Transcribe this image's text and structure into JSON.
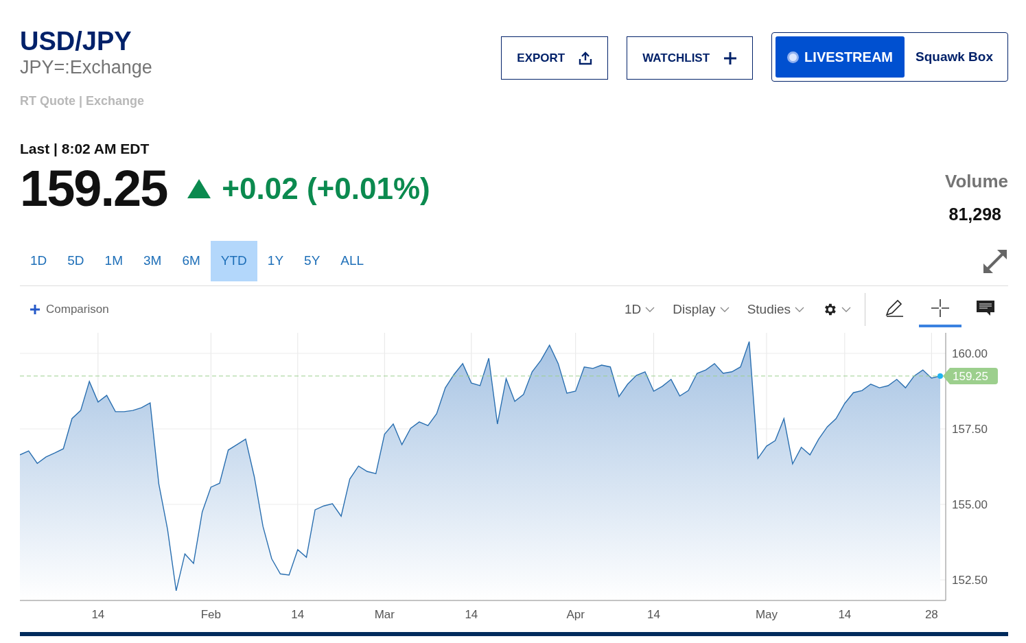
{
  "header": {
    "symbol": "USD/JPY",
    "ticker": "JPY=:Exchange",
    "quote_source": "RT Quote | Exchange"
  },
  "actions": [
    {
      "kind": "export",
      "label": "EXPORT"
    },
    {
      "kind": "watchlist",
      "label": "WATCHLIST"
    }
  ],
  "live": {
    "label": "LIVESTREAM",
    "show": "Squawk Box"
  },
  "quote": {
    "last_label": "Last | 8:02 AM EDT",
    "price": "159.25",
    "change": "+0.02 (+0.01%)",
    "volume_label": "Volume",
    "volume": "81,298"
  },
  "ranges": [
    {
      "label": "1D",
      "selected": false
    },
    {
      "label": "5D",
      "selected": false
    },
    {
      "label": "1M",
      "selected": false
    },
    {
      "label": "3M",
      "selected": false
    },
    {
      "label": "6M",
      "selected": false
    },
    {
      "label": "YTD",
      "selected": true
    },
    {
      "label": "1Y",
      "selected": false
    },
    {
      "label": "5Y",
      "selected": false
    },
    {
      "label": "ALL",
      "selected": false
    }
  ],
  "toolbar": {
    "comparison": "Comparison",
    "menus": [
      {
        "kind": "text",
        "label": "1D"
      },
      {
        "kind": "text",
        "label": "Display"
      },
      {
        "kind": "text",
        "label": "Studies"
      },
      {
        "kind": "settings"
      }
    ],
    "tools": [
      {
        "kind": "draw",
        "selected": false
      },
      {
        "kind": "crosshair",
        "selected": true
      },
      {
        "kind": "comment",
        "selected": false
      }
    ]
  },
  "chart": {
    "chart_data": {
      "type": "area",
      "grid": true,
      "ref_lines": [
        {
          "axis": "y",
          "value": 159.25,
          "label": "159.25",
          "color": "#9ccf8d"
        }
      ],
      "categories": [
        null,
        null,
        null,
        null,
        null,
        null,
        null,
        null,
        null,
        "14",
        null,
        null,
        null,
        null,
        null,
        null,
        null,
        null,
        null,
        null,
        null,
        null,
        "Feb",
        null,
        null,
        null,
        null,
        null,
        null,
        null,
        null,
        null,
        "14",
        null,
        null,
        null,
        null,
        null,
        null,
        null,
        null,
        null,
        "Mar",
        null,
        null,
        null,
        null,
        null,
        null,
        null,
        null,
        null,
        "14",
        null,
        null,
        null,
        null,
        null,
        null,
        null,
        null,
        null,
        null,
        null,
        "Apr",
        null,
        null,
        null,
        null,
        null,
        null,
        null,
        null,
        "14",
        null,
        null,
        null,
        null,
        null,
        null,
        null,
        null,
        null,
        null,
        null,
        null,
        "May",
        null,
        null,
        null,
        null,
        null,
        null,
        null,
        null,
        "14",
        null,
        null,
        null,
        null,
        null,
        null,
        null,
        null,
        null,
        "28",
        null
      ],
      "ylim": [
        151.82,
        160.68
      ],
      "yticks": [
        {
          "value": 152.5,
          "label": "152.50"
        },
        {
          "value": 155,
          "label": "155.00"
        },
        {
          "value": 157.5,
          "label": "157.50"
        },
        {
          "value": 160,
          "label": "160.00"
        }
      ],
      "series": [
        {
          "color": "#2a6fb0",
          "values": [
            156.64,
            156.77,
            156.36,
            156.57,
            156.7,
            156.84,
            157.84,
            158.11,
            159.07,
            158.39,
            158.61,
            158.07,
            158.07,
            158.11,
            158.2,
            158.36,
            155.68,
            154.18,
            152.14,
            153.36,
            153.05,
            154.75,
            155.57,
            155.7,
            156.8,
            156.98,
            157.16,
            155.91,
            154.27,
            153.2,
            152.7,
            152.66,
            153.5,
            153.25,
            154.82,
            154.95,
            155.02,
            154.61,
            155.84,
            156.27,
            156.09,
            156.02,
            157.32,
            157.66,
            156.98,
            157.52,
            157.73,
            157.61,
            158.0,
            158.86,
            159.3,
            159.66,
            159.02,
            158.93,
            159.84,
            157.66,
            159.16,
            158.41,
            158.64,
            159.39,
            159.77,
            160.27,
            159.66,
            158.68,
            158.75,
            159.55,
            159.5,
            159.61,
            159.55,
            158.57,
            158.98,
            159.27,
            159.39,
            158.75,
            158.91,
            159.14,
            158.59,
            158.77,
            159.34,
            159.45,
            159.66,
            159.34,
            159.39,
            159.55,
            160.39,
            156.52,
            156.93,
            157.11,
            157.84,
            156.34,
            156.89,
            156.64,
            157.16,
            157.57,
            157.84,
            158.34,
            158.7,
            158.77,
            158.98,
            158.86,
            158.93,
            159.14,
            158.86,
            159.25,
            159.45,
            159.18,
            159.25
          ]
        }
      ]
    }
  }
}
